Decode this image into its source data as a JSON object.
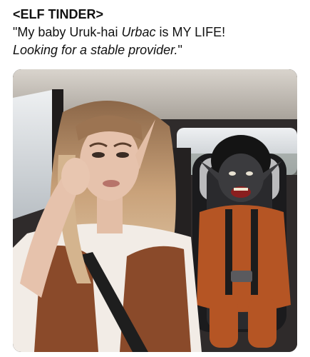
{
  "post": {
    "title": "<ELF TINDER>",
    "line1_prefix": "\"My baby Uruk-hai ",
    "line1_name": "Urbac",
    "line1_suffix": " is MY LIFE!",
    "line2_text": "Looking for a stable provider.",
    "line2_close_quote": "\""
  },
  "image": {
    "description_icon": "photo-car-interior",
    "colors": {
      "car_interior": "#2f2b2b",
      "headliner": "#c9c4bd",
      "window_light": "#dfe3e6",
      "hair": "#b8946c",
      "skin": "#e6c2ac",
      "leather_vest": "#8a4a2a",
      "blouse": "#f2ece6",
      "seatbelt": "#1e1e1e",
      "uruk_skin": "#3b3b3e",
      "uruk_outfit": "#b55524",
      "car_seat": "#1b1b1d"
    }
  }
}
